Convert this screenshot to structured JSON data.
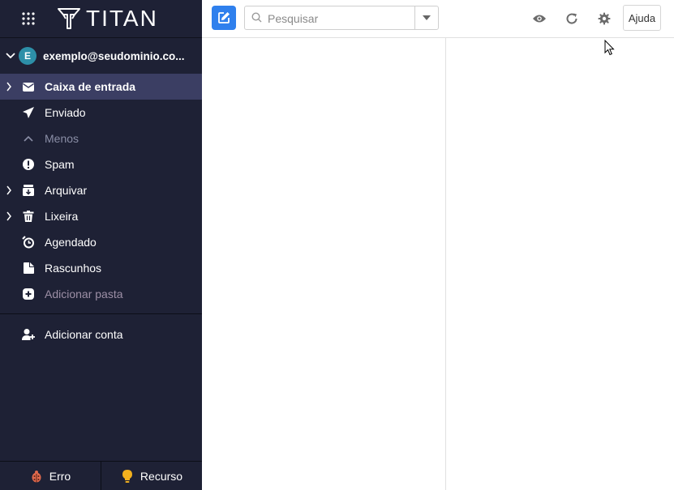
{
  "app": {
    "logo_text": "TITAN"
  },
  "account": {
    "initial": "E",
    "email": "exemplo@seudominio.co..."
  },
  "folders": [
    {
      "label": "Caixa de entrada",
      "icon": "envelope-icon"
    },
    {
      "label": "Enviado",
      "icon": "paper-plane-icon"
    },
    {
      "label": "Menos",
      "icon": "chevron-up-icon"
    },
    {
      "label": "Spam",
      "icon": "exclamation-circle-icon"
    },
    {
      "label": "Arquivar",
      "icon": "archive-icon"
    },
    {
      "label": "Lixeira",
      "icon": "trash-icon"
    },
    {
      "label": "Agendado",
      "icon": "scheduled-clock-icon"
    },
    {
      "label": "Rascunhos",
      "icon": "draft-icon"
    },
    {
      "label": "Adicionar pasta",
      "icon": "plus-square-icon"
    }
  ],
  "add_account": {
    "label": "Adicionar conta",
    "icon": "add-user-icon"
  },
  "bottom": {
    "bug_label": "Erro",
    "feature_label": "Recurso"
  },
  "search": {
    "placeholder": "Pesquisar"
  },
  "toolbar": {
    "help_label": "Ajuda"
  },
  "colors": {
    "sidebar_bg": "#1e2135",
    "active_bg": "#3b3e63",
    "accent": "#2f80ed",
    "avatar": "#2d8fa8"
  }
}
